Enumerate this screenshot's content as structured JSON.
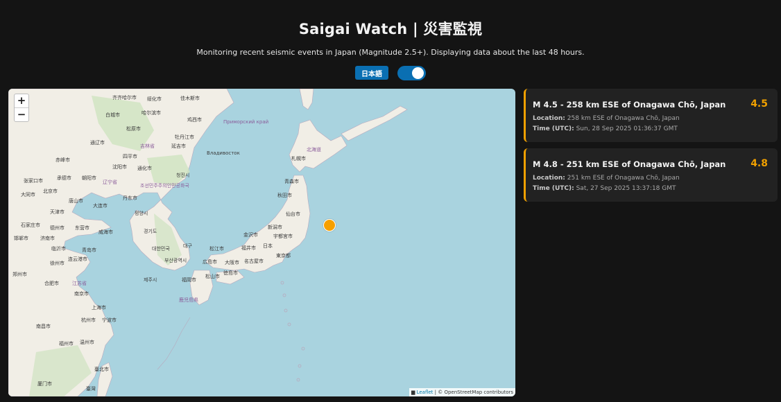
{
  "header": {
    "title": "Saigai Watch | 災害監視",
    "subtitle": "Monitoring recent seismic events in Japan (Magnitude 2.5+). Displaying data about the last 48 hours."
  },
  "controls": {
    "language_button": "日本語",
    "toggle_on": true
  },
  "map": {
    "zoom_in": "+",
    "zoom_out": "−",
    "attribution_leaflet": "Leaflet",
    "attribution_rest": "| © OpenStreetMap contributors",
    "labels": {
      "qiqihar": "齐齐哈尔市",
      "suihua": "绥化市",
      "jiamusi": "佳木斯市",
      "baicheng": "白城市",
      "harbin": "哈尔滨市",
      "jixi": "鸡西市",
      "songyuan": "松原市",
      "mudanjiang": "牡丹江市",
      "jilin": "吉林省",
      "yanji": "延吉市",
      "vladivostok": "Владивосток",
      "primorsky": "Приморский край",
      "tongliao": "通辽市",
      "siping": "四平市",
      "chifeng": "赤峰市",
      "shenyang": "沈阳市",
      "tonghua": "通化市",
      "chongjin": "청진시",
      "zhangjiakou": "张家口市",
      "chengde": "承德市",
      "chaoyang": "朝阳市",
      "liaoning": "辽宁省",
      "beijing": "北京市",
      "dandong": "丹东市",
      "nk": "조선민주주의인민공화국",
      "datong": "大同市",
      "tangshan": "唐山市",
      "dalian": "大连市",
      "pyongyang": "평양시",
      "tianjin": "天津市",
      "shijiazhuang": "石家庄市",
      "dezhou": "德州市",
      "dongying": "东营市",
      "weihai": "威海市",
      "korea_region": "경기도",
      "handan": "邯郸市",
      "jinan": "济南市",
      "sk": "대한민국",
      "qingdao": "青岛市",
      "daegu": "대구",
      "linyi": "临沂市",
      "busan": "부산광역시",
      "xuzhou": "徐州市",
      "lianyungang": "连云港市",
      "zhengzhou": "郑州市",
      "hefei": "合肥市",
      "nanjing": "南京市",
      "jiangsu": "江苏省",
      "shanghai": "上海市",
      "jeju": "제주시",
      "hangzhou": "杭州市",
      "ningbo": "宁波市",
      "wenzhou": "温州市",
      "nanchang": "南昌市",
      "fuzhou": "福州市",
      "xiamen": "厦门市",
      "taipei": "臺北市",
      "taiwan": "臺灣",
      "sapporo": "札幌市",
      "hokkaido": "北海道",
      "aomori": "青森市",
      "akita": "秋田市",
      "sendai": "仙台市",
      "niigata": "新潟市",
      "utsunomiya": "宇都宮市",
      "japan": "日本",
      "tokyo": "東京都",
      "kanazawa": "金沢市",
      "fukui": "福井市",
      "nagoya": "名古屋市",
      "osaka": "大阪市",
      "matsue": "松江市",
      "hiroshima": "広島市",
      "fukuoka": "福岡市",
      "matsuyama": "松山市",
      "tokushima": "徳島市",
      "kagoshima": "鹿児島県"
    }
  },
  "events": [
    {
      "title": "M 4.5 - 258 km ESE of Onagawa Chō, Japan",
      "magnitude": "4.5",
      "location_label": "Location:",
      "location": "258 km ESE of Onagawa Chō, Japan",
      "time_label": "Time (UTC):",
      "time": "Sun, 28 Sep 2025 01:36:37 GMT"
    },
    {
      "title": "M 4.8 - 251 km ESE of Onagawa Chō, Japan",
      "magnitude": "4.8",
      "location_label": "Location:",
      "location": "251 km ESE of Onagawa Chō, Japan",
      "time_label": "Time (UTC):",
      "time": "Sat, 27 Sep 2025 13:37:18 GMT"
    }
  ],
  "colors": {
    "background": "#141414",
    "accent": "#0a6fb2",
    "magnitude": "#f0a000",
    "sea": "#a9d3df",
    "land": "#f1eee6"
  }
}
